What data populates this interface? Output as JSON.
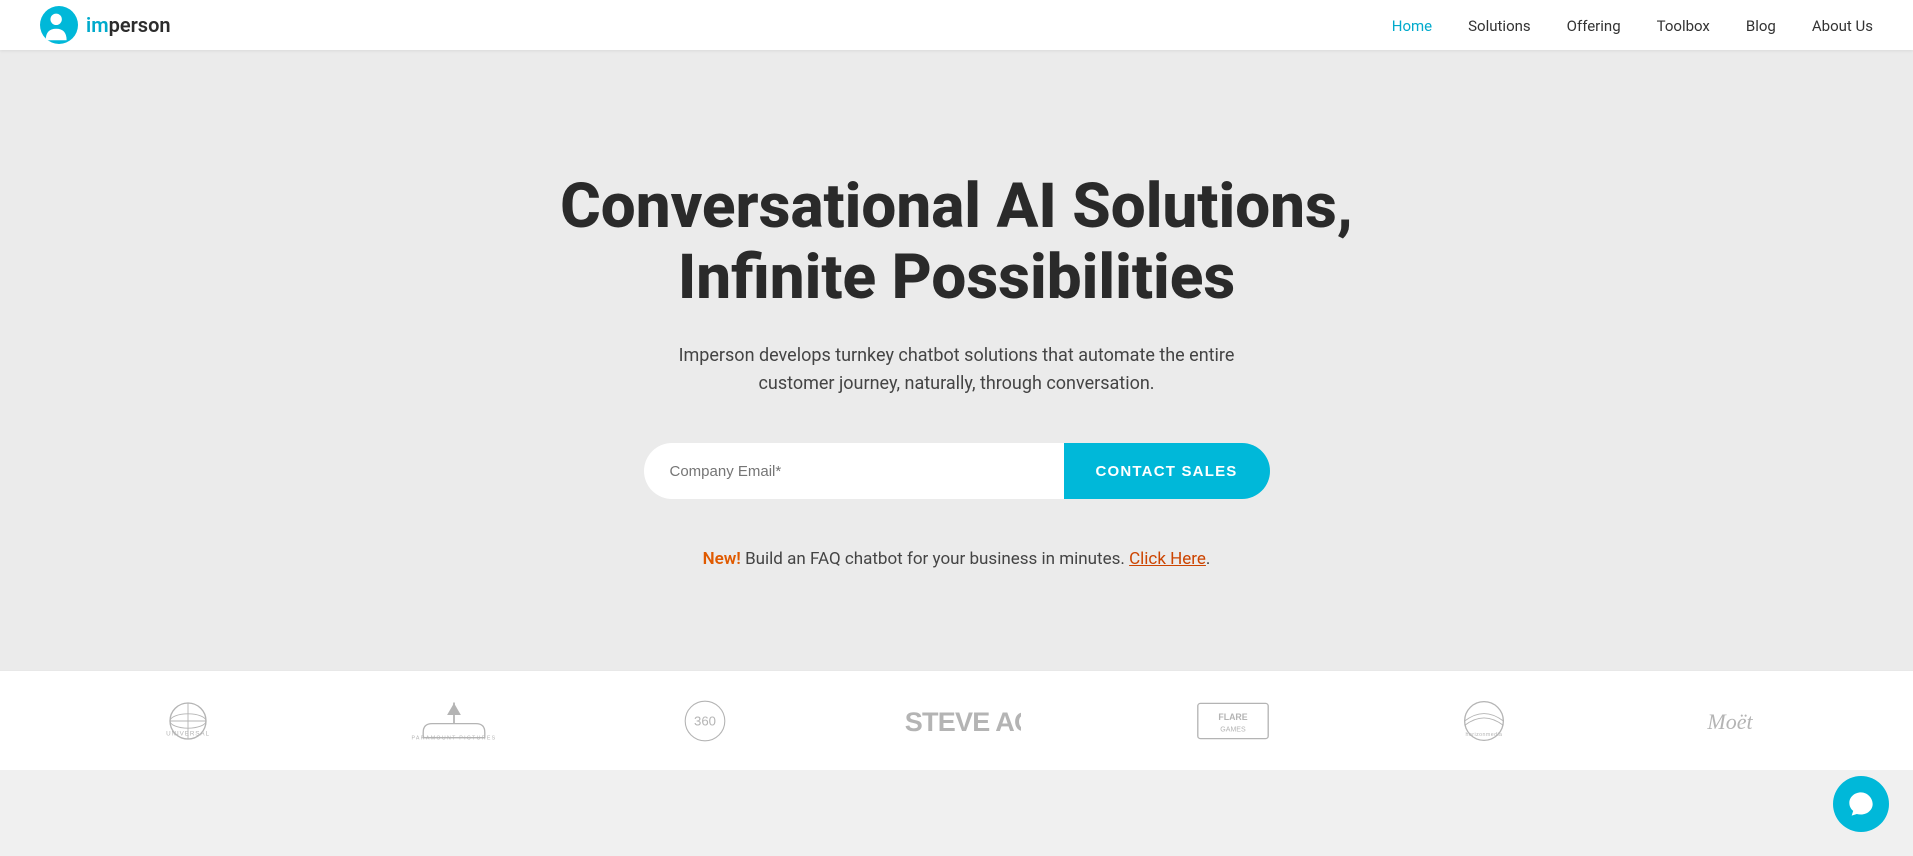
{
  "nav": {
    "logo_text_im": "im",
    "logo_text_person": "person",
    "links": [
      {
        "id": "home",
        "label": "Home",
        "active": true
      },
      {
        "id": "solutions",
        "label": "Solutions",
        "active": false
      },
      {
        "id": "offering",
        "label": "Offering",
        "active": false
      },
      {
        "id": "toolbox",
        "label": "Toolbox",
        "active": false
      },
      {
        "id": "blog",
        "label": "Blog",
        "active": false
      },
      {
        "id": "about",
        "label": "About Us",
        "active": false
      }
    ]
  },
  "hero": {
    "title_line1": "Conversational AI Solutions,",
    "title_line2": "Infinite Possibilities",
    "subtitle": "Imperson develops turnkey chatbot solutions that automate the entire customer journey, naturally, through conversation.",
    "email_placeholder": "Company Email*",
    "cta_button": "CONTACT SALES",
    "new_label": "New!",
    "new_text": " Build an FAQ chatbot for your business in minutes. ",
    "click_here": "Click Here",
    "period": "."
  },
  "logos": [
    {
      "id": "universal",
      "name": "Universal"
    },
    {
      "id": "paramount",
      "name": "Paramount"
    },
    {
      "id": "360",
      "name": "360"
    },
    {
      "id": "steveaoki",
      "name": "Steve Aoki"
    },
    {
      "id": "flaregames",
      "name": "Flare Games"
    },
    {
      "id": "horizonmedia",
      "name": "Horizon Media"
    },
    {
      "id": "moet",
      "name": "Moët"
    }
  ],
  "chat": {
    "label": "chat-bubble"
  }
}
